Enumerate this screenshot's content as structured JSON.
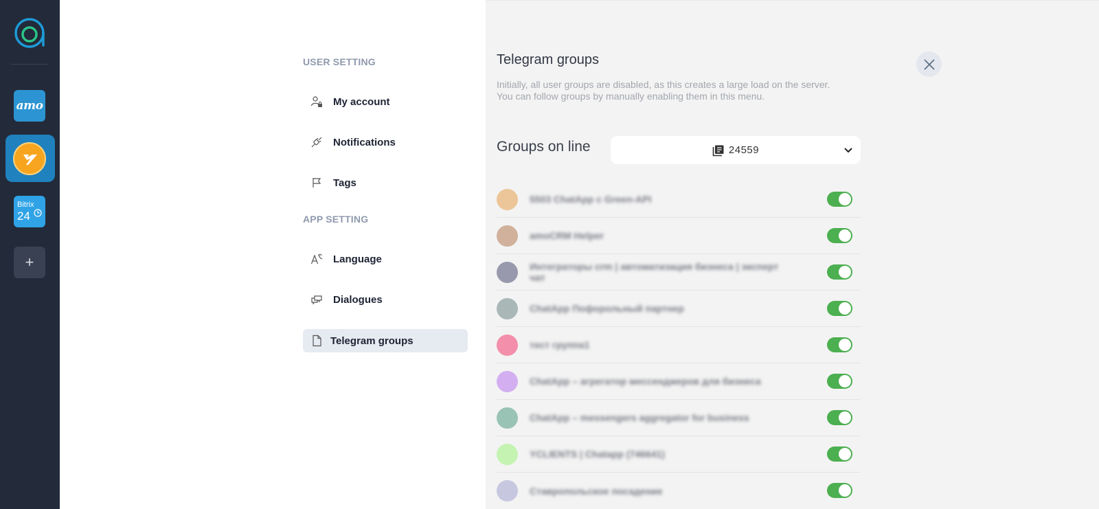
{
  "rail": {
    "apps": [
      {
        "name": "amo",
        "label": "amo"
      },
      {
        "name": "yclients",
        "label": ""
      },
      {
        "name": "bitrix24",
        "label_top": "Bitrix",
        "label_bottom": "24"
      }
    ],
    "add_label": "+"
  },
  "menu": {
    "user_section": "USER SETTING",
    "app_section": "APP SETTING",
    "items": [
      {
        "label": "My account",
        "icon": "user-lock-icon"
      },
      {
        "label": "Notifications",
        "icon": "plug-icon"
      },
      {
        "label": "Tags",
        "icon": "flag-icon"
      },
      {
        "label": "Language",
        "icon": "translate-icon"
      },
      {
        "label": "Dialogues",
        "icon": "chat-bubbles-icon"
      },
      {
        "label": "Telegram groups",
        "icon": "document-icon",
        "active": true
      }
    ]
  },
  "panel": {
    "title": "Telegram groups",
    "description": "Initially, all user groups are disabled, as this creates a large load on the server. You can follow groups by manually enabling them in this menu.",
    "groups_label": "Groups on line",
    "line_value": "24559",
    "groups": [
      {
        "name": "5503 ChatApp с Green-API",
        "color": "#e6a04c",
        "enabled": true
      },
      {
        "name": "amoCRM Helper",
        "color": "#b57a54",
        "enabled": true
      },
      {
        "name": "Интеграторы crm | автоматизация бизнеса | эксперт чат",
        "color": "#4e4e72",
        "enabled": true
      },
      {
        "name": "ChatApp Пофорольный партнер",
        "color": "#6d8585",
        "enabled": true
      },
      {
        "name": "тест группа1",
        "color": "#f23d6e",
        "enabled": true
      },
      {
        "name": "ChatApp – агрегатор мессенджеров для бизнеса",
        "color": "#b877ef",
        "enabled": true
      },
      {
        "name": "ChatApp – messengers aggregator for business",
        "color": "#4f9a82",
        "enabled": true
      },
      {
        "name": "YCLIENTS | Chatapp (746641)",
        "color": "#9ef27c",
        "enabled": true
      },
      {
        "name": "Ставропольское посадение",
        "color": "#a2a2cf",
        "enabled": true
      }
    ]
  },
  "colors": {
    "rail_bg": "#232a39",
    "accent": "#1f82be",
    "toggle_on": "#4caf50",
    "panel_bg": "#f3f3f3"
  }
}
